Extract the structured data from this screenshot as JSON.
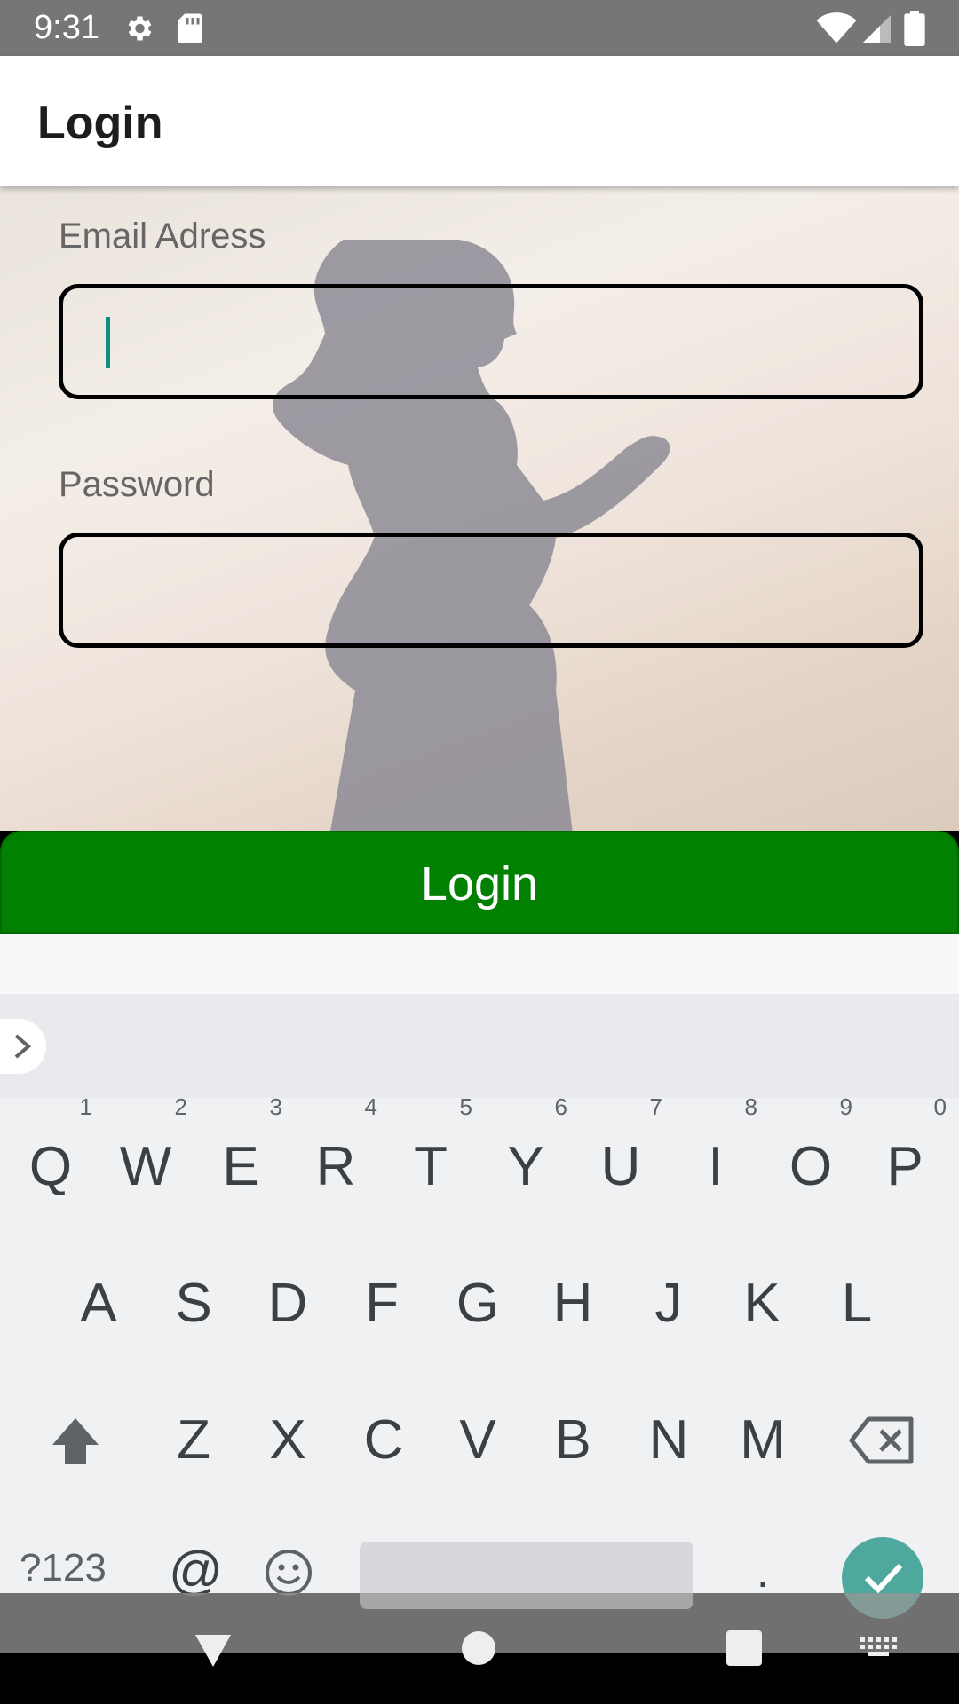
{
  "status_bar": {
    "time": "9:31",
    "icons": [
      "gear-icon",
      "sd-card-icon",
      "wifi-icon",
      "signal-icon",
      "battery-icon"
    ]
  },
  "app_bar": {
    "title": "Login"
  },
  "form": {
    "email": {
      "label": "Email Adress",
      "value": "",
      "placeholder": ""
    },
    "password": {
      "label": "Password",
      "value": "",
      "placeholder": ""
    }
  },
  "login_button": {
    "label": "Login",
    "color": "#028002"
  },
  "keyboard": {
    "row1": [
      {
        "key": "Q",
        "hint": "1"
      },
      {
        "key": "W",
        "hint": "2"
      },
      {
        "key": "E",
        "hint": "3"
      },
      {
        "key": "R",
        "hint": "4"
      },
      {
        "key": "T",
        "hint": "5"
      },
      {
        "key": "Y",
        "hint": "6"
      },
      {
        "key": "U",
        "hint": "7"
      },
      {
        "key": "I",
        "hint": "8"
      },
      {
        "key": "O",
        "hint": "9"
      },
      {
        "key": "P",
        "hint": "0"
      }
    ],
    "row2": [
      "A",
      "S",
      "D",
      "F",
      "G",
      "H",
      "J",
      "K",
      "L"
    ],
    "row3": [
      "Z",
      "X",
      "C",
      "V",
      "B",
      "N",
      "M"
    ],
    "symbols_label": "?123",
    "at_label": "@",
    "period_label": ".",
    "enter_color": "#4fa89d"
  }
}
